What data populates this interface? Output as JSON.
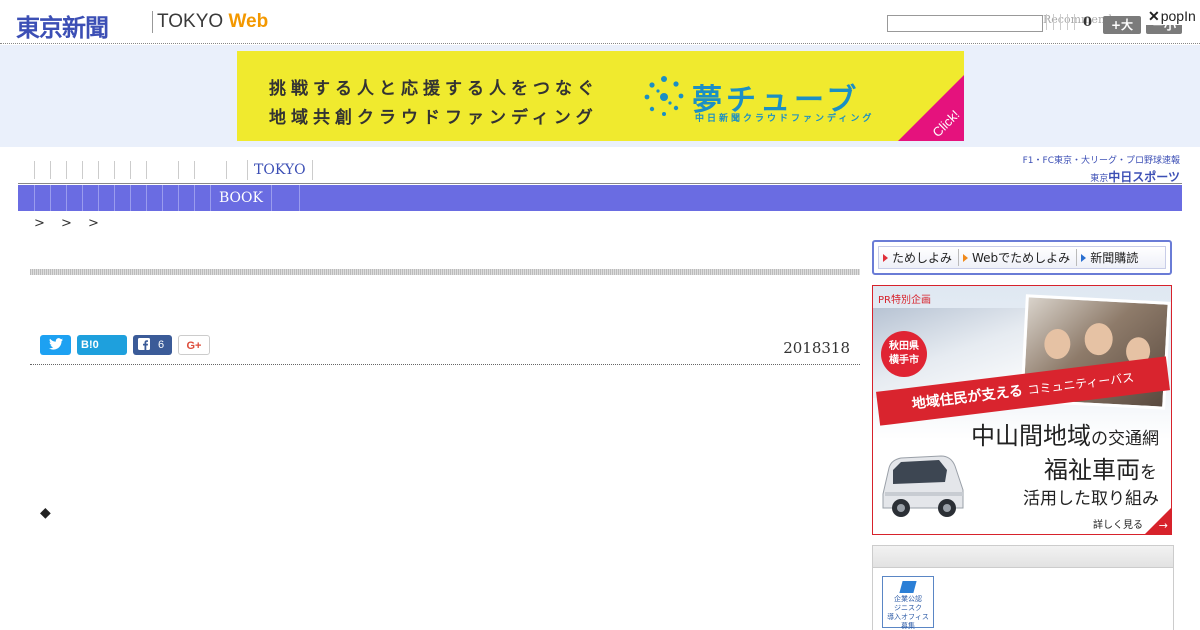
{
  "header": {
    "logo_jp": "東京新聞",
    "logo_en_tokyo": "TOKYO",
    "logo_en_web": "Web",
    "search_placeholder": "",
    "recommend_label": "Recommend",
    "recommend_count": "0",
    "font_larger": "+大",
    "font_smaller": "－小",
    "popin_close": "✕",
    "popin_label": "popIn"
  },
  "banner": {
    "line1": "挑戦する人と応援する人をつなぐ",
    "line2": "地域共創クラウドファンディング",
    "brand": "夢チューブ",
    "sub": "中日新聞クラウドファンディング",
    "click": "Click!"
  },
  "nav": {
    "tokyo_label": "TOKYO",
    "chunichi_top": "F1・FC東京・大リーグ・プロ野球速報",
    "chunichi_bottom_small": "東京",
    "chunichi_bottom": "中日スポーツ"
  },
  "bluebar": {
    "book_label": "BOOK"
  },
  "breadcrumb": {
    "text": ">  > >"
  },
  "article": {
    "date": "2018318",
    "diamond": "◆"
  },
  "share": {
    "hatena_label": "B!",
    "hatena_count": "0",
    "facebook_count": "6",
    "gplus_label": "G+"
  },
  "sidebar": {
    "tameshi_items": [
      "ためしよみ",
      "Webでためしよみ",
      "新聞購読"
    ],
    "pr": {
      "label": "PR特別企画",
      "city_line1": "秋田県",
      "city_line2": "横手市",
      "ribbon_main": "地域住民が支える",
      "ribbon_sub": "コミュニティーバス",
      "head1_big": "中山間地域",
      "head1_small": "の交通網",
      "head2_big": "福祉車両",
      "head2_small": "を",
      "head3": "活用した取り組み",
      "more": "詳しく見る",
      "more_arrow": "→"
    },
    "jobs_badge": {
      "line1": "企業公認",
      "line2": "ジニスク",
      "line3": "導入オフィス",
      "line4": "募集"
    }
  },
  "colors": {
    "brand_blue": "#3c4fb5",
    "nav_bar": "#6a6ce2",
    "web_orange": "#f39800",
    "banner_yellow": "#f0ea2e",
    "banner_teal": "#1b8fc4",
    "banner_magenta": "#e5127d",
    "pr_red": "#d7222b"
  },
  "icons": {
    "twitter": "twitter-icon",
    "facebook": "facebook-icon"
  }
}
